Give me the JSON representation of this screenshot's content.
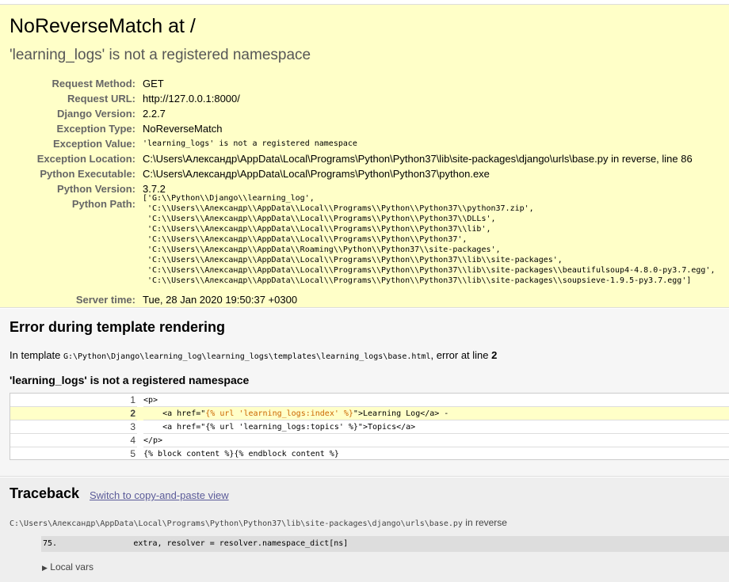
{
  "summary": {
    "title": "NoReverseMatch at /",
    "subtitle": "'learning_logs' is not a registered namespace",
    "meta": [
      {
        "label": "Request Method:",
        "value": "GET"
      },
      {
        "label": "Request URL:",
        "value": "http://127.0.0.1:8000/"
      },
      {
        "label": "Django Version:",
        "value": "2.2.7"
      },
      {
        "label": "Exception Type:",
        "value": "NoReverseMatch"
      },
      {
        "label": "Exception Value:",
        "value": "'learning_logs' is not a registered namespace"
      },
      {
        "label": "Exception Location:",
        "value": "C:\\Users\\Александр\\AppData\\Local\\Programs\\Python\\Python37\\lib\\site-packages\\django\\urls\\base.py in reverse, line 86"
      },
      {
        "label": "Python Executable:",
        "value": "C:\\Users\\Александр\\AppData\\Local\\Programs\\Python\\Python37\\python.exe"
      },
      {
        "label": "Python Version:",
        "value": "3.7.2"
      },
      {
        "label": "Python Path:",
        "value": ""
      },
      {
        "label": "Server time:",
        "value": "Tue, 28 Jan 2020 19:50:37 +0300"
      }
    ],
    "python_path": "['G:\\\\Python\\\\Django\\\\learning_log',\n 'C:\\\\Users\\\\Александр\\\\AppData\\\\Local\\\\Programs\\\\Python\\\\Python37\\\\python37.zip',\n 'C:\\\\Users\\\\Александр\\\\AppData\\\\Local\\\\Programs\\\\Python\\\\Python37\\\\DLLs',\n 'C:\\\\Users\\\\Александр\\\\AppData\\\\Local\\\\Programs\\\\Python\\\\Python37\\\\lib',\n 'C:\\\\Users\\\\Александр\\\\AppData\\\\Local\\\\Programs\\\\Python\\\\Python37',\n 'C:\\\\Users\\\\Александр\\\\AppData\\\\Roaming\\\\Python\\\\Python37\\\\site-packages',\n 'C:\\\\Users\\\\Александр\\\\AppData\\\\Local\\\\Programs\\\\Python\\\\Python37\\\\lib\\\\site-packages',\n 'C:\\\\Users\\\\Александр\\\\AppData\\\\Local\\\\Programs\\\\Python\\\\Python37\\\\lib\\\\site-packages\\\\beautifulsoup4-4.8.0-py3.7.egg',\n 'C:\\\\Users\\\\Александр\\\\AppData\\\\Local\\\\Programs\\\\Python\\\\Python37\\\\lib\\\\site-packages\\\\soupsieve-1.9.5-py3.7.egg']"
  },
  "template": {
    "heading": "Error during template rendering",
    "intro_prefix": "In template ",
    "template_path": "G:\\Python\\Django\\learning_log\\learning_logs\\templates\\learning_logs\\base.html",
    "intro_middle": ", error at line ",
    "error_line": "2",
    "error_message": "'learning_logs' is not a registered namespace",
    "source_lines": [
      {
        "num": "1",
        "code": "<p>",
        "pre": "",
        "hl": "",
        "post": ""
      },
      {
        "num": "2",
        "code": "",
        "pre": "    <a href=\"",
        "hl": "{% url 'learning_logs:index' %}",
        "post": "\">Learning Log</a> -"
      },
      {
        "num": "3",
        "code": "    <a href=\"{% url 'learning_logs:topics' %}\">Topics</a>",
        "pre": "",
        "hl": "",
        "post": ""
      },
      {
        "num": "4",
        "code": "</p>",
        "pre": "",
        "hl": "",
        "post": ""
      },
      {
        "num": "5",
        "code": "{% block content %}{% endblock content %}",
        "pre": "",
        "hl": "",
        "post": ""
      }
    ]
  },
  "traceback": {
    "heading": "Traceback",
    "switch_link": "Switch to copy-and-paste view",
    "frame_file": "C:\\Users\\Александр\\AppData\\Local\\Programs\\Python\\Python37\\lib\\site-packages\\django\\urls\\base.py",
    "frame_func": " in reverse",
    "context_line": "75.                extra, resolver = resolver.namespace_dict[ns]",
    "local_vars": "Local vars"
  }
}
